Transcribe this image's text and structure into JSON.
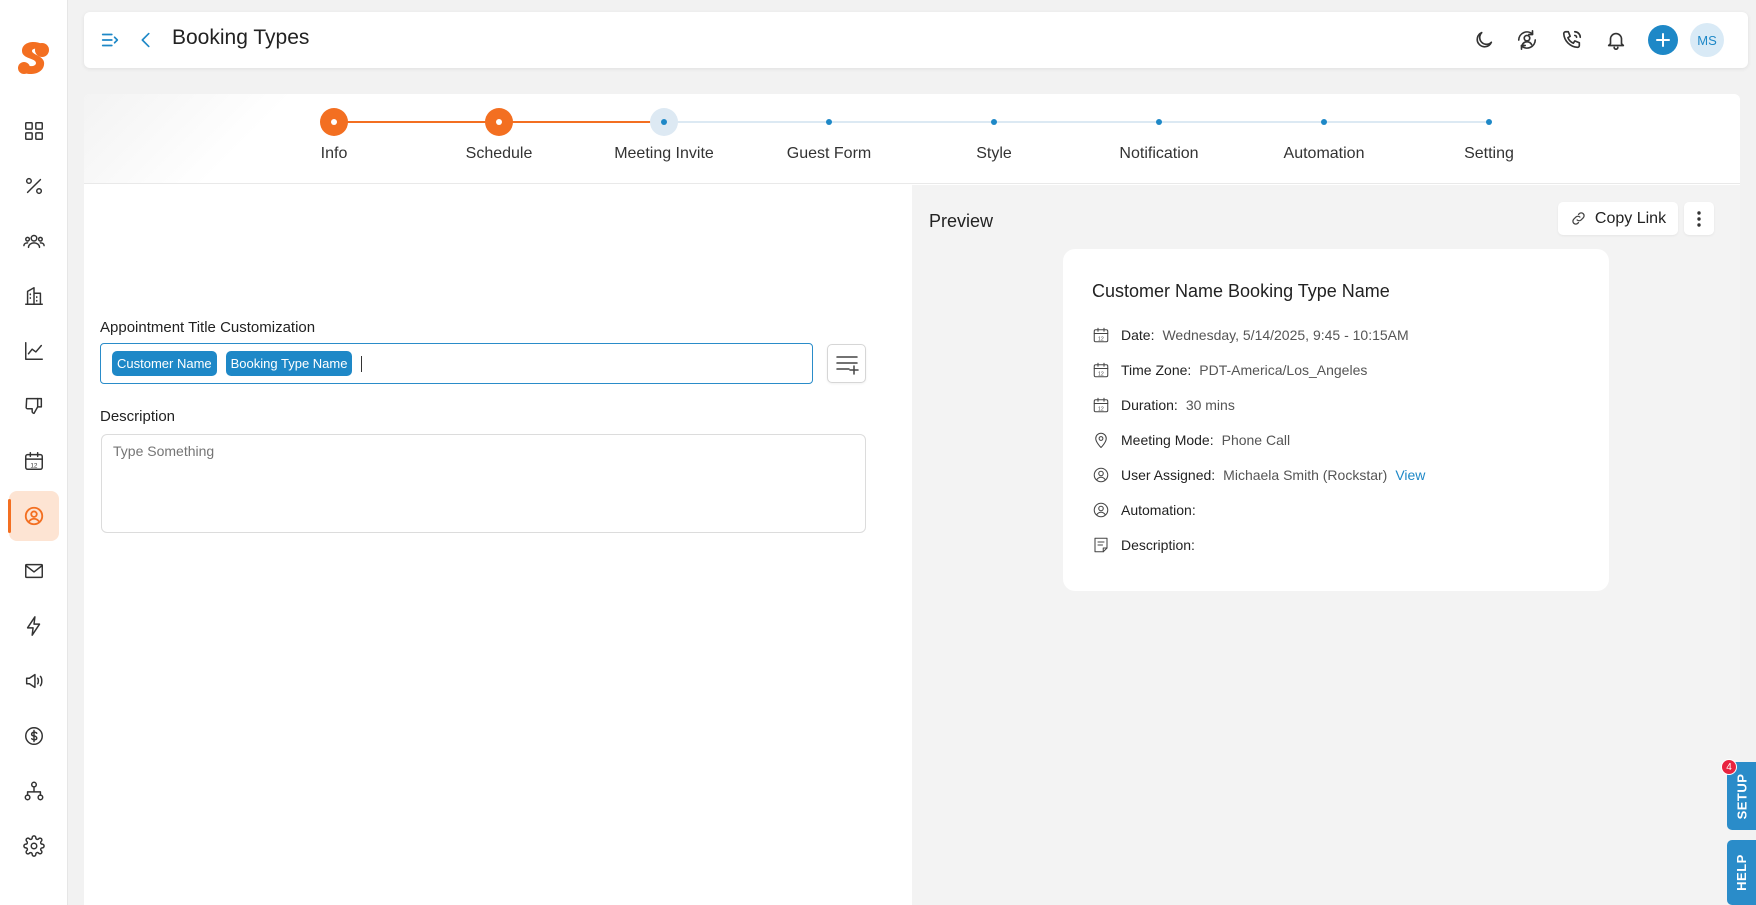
{
  "header": {
    "title": "Booking Types",
    "avatar_initials": "MS",
    "icons": [
      "sidebar-toggle-icon",
      "back-icon",
      "moon-icon",
      "sync-user-icon",
      "phone-icon",
      "bell-icon",
      "plus-icon"
    ]
  },
  "sidebar": {
    "items": [
      {
        "name": "dashboard",
        "icon": "grid-icon"
      },
      {
        "name": "deals",
        "icon": "percent-icon"
      },
      {
        "name": "contacts",
        "icon": "users-icon"
      },
      {
        "name": "companies",
        "icon": "building-icon"
      },
      {
        "name": "reports",
        "icon": "chart-icon"
      },
      {
        "name": "feedback",
        "icon": "thumbs-down-icon"
      },
      {
        "name": "calendar",
        "icon": "calendar-icon"
      },
      {
        "name": "booking",
        "icon": "user-circle-icon",
        "active": true
      },
      {
        "name": "email",
        "icon": "mail-icon"
      },
      {
        "name": "automation",
        "icon": "bolt-icon"
      },
      {
        "name": "campaigns",
        "icon": "megaphone-icon"
      },
      {
        "name": "billing",
        "icon": "dollar-icon"
      },
      {
        "name": "workflow",
        "icon": "hierarchy-icon"
      },
      {
        "name": "settings",
        "icon": "gear-icon"
      }
    ]
  },
  "stepper": {
    "steps": [
      {
        "label": "Info",
        "state": "done"
      },
      {
        "label": "Schedule",
        "state": "done"
      },
      {
        "label": "Meeting Invite",
        "state": "current"
      },
      {
        "label": "Guest Form",
        "state": "pending"
      },
      {
        "label": "Style",
        "state": "pending"
      },
      {
        "label": "Notification",
        "state": "pending"
      },
      {
        "label": "Automation",
        "state": "pending"
      },
      {
        "label": "Setting",
        "state": "pending"
      }
    ]
  },
  "form": {
    "title_label": "Appointment Title Customization",
    "title_chips": [
      "Customer Name",
      "Booking Type Name"
    ],
    "description_label": "Description",
    "description_placeholder": "Type Something"
  },
  "preview": {
    "heading": "Preview",
    "copy_link_label": "Copy Link",
    "card_title": "Customer Name Booking Type Name",
    "rows": [
      {
        "key": "Date:",
        "value": "Wednesday, 5/14/2025, 9:45 - 10:15AM",
        "icon": "calendar-icon"
      },
      {
        "key": "Time Zone:",
        "value": "PDT-America/Los_Angeles",
        "icon": "calendar-icon"
      },
      {
        "key": "Duration:",
        "value": "30 mins",
        "icon": "calendar-icon"
      },
      {
        "key": "Meeting Mode:",
        "value": "Phone Call",
        "icon": "location-pin-icon"
      },
      {
        "key": "User Assigned:",
        "value": "Michaela Smith (Rockstar)",
        "link": "View",
        "icon": "user-circle-icon"
      },
      {
        "key": "Automation:",
        "value": "",
        "icon": "user-circle-icon"
      },
      {
        "key": "Description:",
        "value": "",
        "icon": "note-icon"
      }
    ]
  },
  "floating": {
    "setup_label": "SETUP",
    "setup_badge": "4",
    "help_label": "HELP"
  },
  "colors": {
    "accent_orange": "#f36f21",
    "accent_blue": "#1e88c7"
  }
}
